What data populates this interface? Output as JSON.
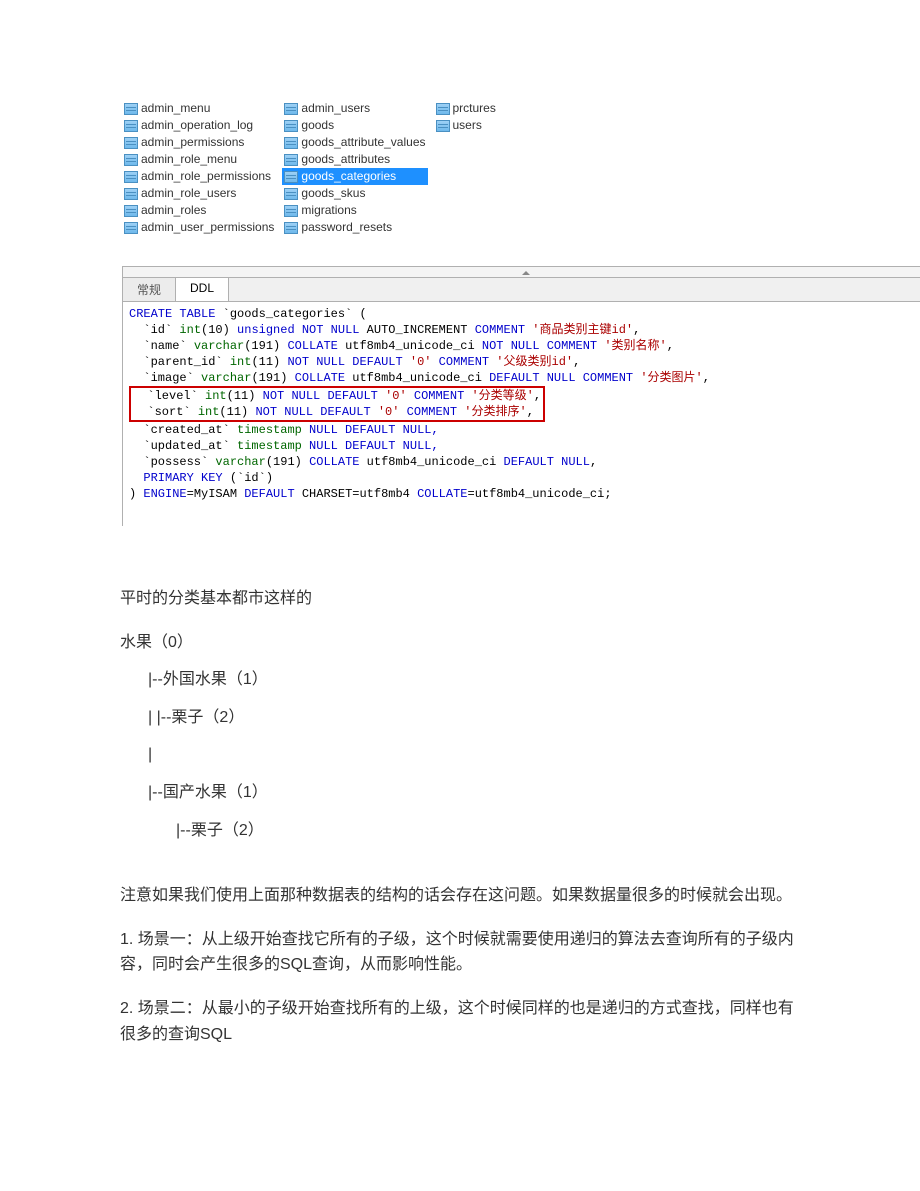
{
  "tables": {
    "col1": [
      "admin_menu",
      "admin_operation_log",
      "admin_permissions",
      "admin_role_menu",
      "admin_role_permissions",
      "admin_role_users",
      "admin_roles",
      "admin_user_permissions"
    ],
    "col2": [
      "admin_users",
      "goods",
      "goods_attribute_values",
      "goods_attributes",
      "goods_categories",
      "goods_skus",
      "migrations",
      "password_resets"
    ],
    "col2_selected": "goods_categories",
    "col3": [
      "prctures",
      "users"
    ]
  },
  "tabs": {
    "t1": "常规",
    "t2": "DDL"
  },
  "sql": {
    "l1a": "CREATE TABLE",
    "l1b": "`goods_categories`",
    "l1c": " (",
    "l2a": "  `id` ",
    "l2b": "int",
    "l2c": "(10) ",
    "l2d": "unsigned NOT NULL",
    "l2e": " AUTO_INCREMENT ",
    "l2f": "COMMENT ",
    "l2g": "'商品类别主键id'",
    "l2h": ",",
    "l3a": "  `name` ",
    "l3b": "varchar",
    "l3c": "(191) ",
    "l3d": "COLLATE",
    "l3e": " utf8mb4_unicode_ci ",
    "l3f": "NOT NULL COMMENT ",
    "l3g": "'类别名称'",
    "l3h": ",",
    "l4a": "  `parent_id` ",
    "l4b": "int",
    "l4c": "(11) ",
    "l4d": "NOT NULL DEFAULT ",
    "l4e": "'0'",
    "l4f": " COMMENT ",
    "l4g": "'父级类别id'",
    "l4h": ",",
    "l5a": "  `image` ",
    "l5b": "varchar",
    "l5c": "(191) ",
    "l5d": "COLLATE",
    "l5e": " utf8mb4_unicode_ci ",
    "l5f": "DEFAULT NULL COMMENT ",
    "l5g": "'分类图片'",
    "l5h": ",",
    "l6a": "  `level` ",
    "l6b": "int",
    "l6c": "(11) ",
    "l6d": "NOT NULL DEFAULT ",
    "l6e": "'0'",
    "l6f": " COMMENT ",
    "l6g": "'分类等级'",
    "l6h": ",",
    "l7a": "  `sort` ",
    "l7b": "int",
    "l7c": "(11) ",
    "l7d": "NOT NULL DEFAULT ",
    "l7e": "'0'",
    "l7f": " COMMENT ",
    "l7g": "'分类排序'",
    "l7h": ",",
    "l8a": "  `created_at` ",
    "l8b": "timestamp",
    "l8c": " NULL DEFAULT NULL,",
    "l9a": "  `updated_at` ",
    "l9b": "timestamp",
    "l9c": " NULL DEFAULT NULL,",
    "l10a": "  `possess` ",
    "l10b": "varchar",
    "l10c": "(191) ",
    "l10d": "COLLATE",
    "l10e": " utf8mb4_unicode_ci ",
    "l10f": "DEFAULT NULL",
    "l10g": ",",
    "l11a": "  PRIMARY KEY ",
    "l11b": "(`id`)",
    "l12a": ") ",
    "l12b": "ENGINE",
    "l12c": "=MyISAM ",
    "l12d": "DEFAULT",
    "l12e": " CHARSET=utf8mb4 ",
    "l12f": "COLLATE",
    "l12g": "=utf8mb4_unicode_ci;"
  },
  "prose": {
    "p1": "平时的分类基本都市这样的",
    "t0": "水果（0）",
    "t1": "|--外国水果（1）",
    "t2": "|    |--栗子（2）",
    "t3": "|",
    "t4": "|--国产水果（1）",
    "t5": "|--栗子（2）",
    "p2": "注意如果我们使用上面那种数据表的结构的话会存在这问题。如果数据量很多的时候就会出现。",
    "p3": "1.      场景一：从上级开始查找它所有的子级，这个时候就需要使用递归的算法去查询所有的子级内容，同时会产生很多的SQL查询，从而影响性能。",
    "p4": "2.      场景二：从最小的子级开始查找所有的上级，这个时候同样的也是递归的方式查找，同样也有很多的查询SQL"
  }
}
